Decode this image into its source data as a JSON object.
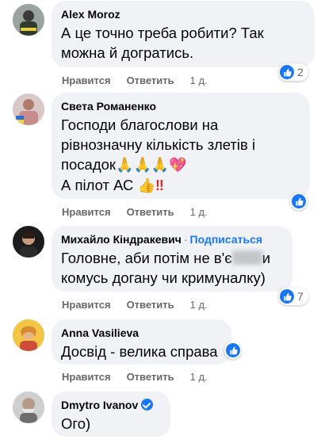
{
  "action_labels": {
    "like": "Нравится",
    "reply": "Ответить"
  },
  "comments": [
    {
      "author": "Alex Moroz",
      "lines": [
        "А це точно треба робити? Так",
        "можна й догратись."
      ],
      "time": "1 д.",
      "reaction_count": "2"
    },
    {
      "author": "Света Романенко",
      "lines": [
        "Господи благослови на",
        "рівнозначну кількість злетів і",
        "посадок",
        "А пілот АС"
      ],
      "emoji_pray": "🙏🙏🙏",
      "emoji_heart": "💖",
      "emoji_thumb": "👍",
      "emoji_bang": "‼",
      "time": "1 д."
    },
    {
      "author": "Михайло Кіндракевич",
      "separator": "·",
      "follow": "Подписаться",
      "line1_before": "Головне, аби потім не в'є",
      "line1_after": "и",
      "line2": "комусь догану чи кримуналку)",
      "time": "1 д.",
      "reaction_count": "7"
    },
    {
      "author": "Anna Vasilieva",
      "lines": [
        "Досвід - велика справа"
      ],
      "time": "1 д."
    },
    {
      "author": "Dmytro Ivanov",
      "lines": [
        "Ого)"
      ]
    }
  ],
  "colors": {
    "link": "#1877f2",
    "bubble": "#f0f2f5",
    "meta": "#65676b"
  },
  "icons": [
    "like-icon",
    "verified-icon"
  ]
}
